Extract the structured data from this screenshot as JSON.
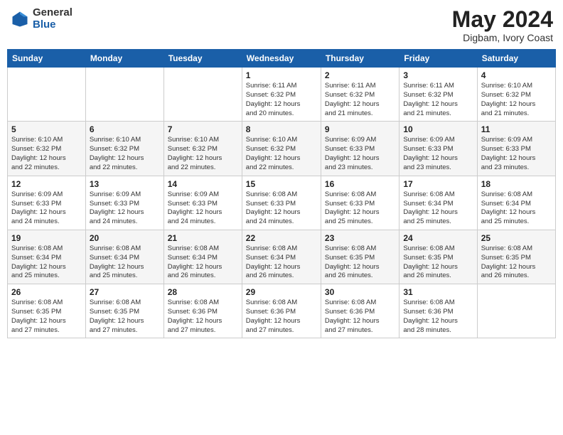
{
  "header": {
    "logo_general": "General",
    "logo_blue": "Blue",
    "month_year": "May 2024",
    "location": "Digbam, Ivory Coast"
  },
  "weekdays": [
    "Sunday",
    "Monday",
    "Tuesday",
    "Wednesday",
    "Thursday",
    "Friday",
    "Saturday"
  ],
  "weeks": [
    [
      {
        "day": "",
        "info": ""
      },
      {
        "day": "",
        "info": ""
      },
      {
        "day": "",
        "info": ""
      },
      {
        "day": "1",
        "info": "Sunrise: 6:11 AM\nSunset: 6:32 PM\nDaylight: 12 hours\nand 20 minutes."
      },
      {
        "day": "2",
        "info": "Sunrise: 6:11 AM\nSunset: 6:32 PM\nDaylight: 12 hours\nand 21 minutes."
      },
      {
        "day": "3",
        "info": "Sunrise: 6:11 AM\nSunset: 6:32 PM\nDaylight: 12 hours\nand 21 minutes."
      },
      {
        "day": "4",
        "info": "Sunrise: 6:10 AM\nSunset: 6:32 PM\nDaylight: 12 hours\nand 21 minutes."
      }
    ],
    [
      {
        "day": "5",
        "info": "Sunrise: 6:10 AM\nSunset: 6:32 PM\nDaylight: 12 hours\nand 22 minutes."
      },
      {
        "day": "6",
        "info": "Sunrise: 6:10 AM\nSunset: 6:32 PM\nDaylight: 12 hours\nand 22 minutes."
      },
      {
        "day": "7",
        "info": "Sunrise: 6:10 AM\nSunset: 6:32 PM\nDaylight: 12 hours\nand 22 minutes."
      },
      {
        "day": "8",
        "info": "Sunrise: 6:10 AM\nSunset: 6:32 PM\nDaylight: 12 hours\nand 22 minutes."
      },
      {
        "day": "9",
        "info": "Sunrise: 6:09 AM\nSunset: 6:33 PM\nDaylight: 12 hours\nand 23 minutes."
      },
      {
        "day": "10",
        "info": "Sunrise: 6:09 AM\nSunset: 6:33 PM\nDaylight: 12 hours\nand 23 minutes."
      },
      {
        "day": "11",
        "info": "Sunrise: 6:09 AM\nSunset: 6:33 PM\nDaylight: 12 hours\nand 23 minutes."
      }
    ],
    [
      {
        "day": "12",
        "info": "Sunrise: 6:09 AM\nSunset: 6:33 PM\nDaylight: 12 hours\nand 24 minutes."
      },
      {
        "day": "13",
        "info": "Sunrise: 6:09 AM\nSunset: 6:33 PM\nDaylight: 12 hours\nand 24 minutes."
      },
      {
        "day": "14",
        "info": "Sunrise: 6:09 AM\nSunset: 6:33 PM\nDaylight: 12 hours\nand 24 minutes."
      },
      {
        "day": "15",
        "info": "Sunrise: 6:08 AM\nSunset: 6:33 PM\nDaylight: 12 hours\nand 24 minutes."
      },
      {
        "day": "16",
        "info": "Sunrise: 6:08 AM\nSunset: 6:33 PM\nDaylight: 12 hours\nand 25 minutes."
      },
      {
        "day": "17",
        "info": "Sunrise: 6:08 AM\nSunset: 6:34 PM\nDaylight: 12 hours\nand 25 minutes."
      },
      {
        "day": "18",
        "info": "Sunrise: 6:08 AM\nSunset: 6:34 PM\nDaylight: 12 hours\nand 25 minutes."
      }
    ],
    [
      {
        "day": "19",
        "info": "Sunrise: 6:08 AM\nSunset: 6:34 PM\nDaylight: 12 hours\nand 25 minutes."
      },
      {
        "day": "20",
        "info": "Sunrise: 6:08 AM\nSunset: 6:34 PM\nDaylight: 12 hours\nand 25 minutes."
      },
      {
        "day": "21",
        "info": "Sunrise: 6:08 AM\nSunset: 6:34 PM\nDaylight: 12 hours\nand 26 minutes."
      },
      {
        "day": "22",
        "info": "Sunrise: 6:08 AM\nSunset: 6:34 PM\nDaylight: 12 hours\nand 26 minutes."
      },
      {
        "day": "23",
        "info": "Sunrise: 6:08 AM\nSunset: 6:35 PM\nDaylight: 12 hours\nand 26 minutes."
      },
      {
        "day": "24",
        "info": "Sunrise: 6:08 AM\nSunset: 6:35 PM\nDaylight: 12 hours\nand 26 minutes."
      },
      {
        "day": "25",
        "info": "Sunrise: 6:08 AM\nSunset: 6:35 PM\nDaylight: 12 hours\nand 26 minutes."
      }
    ],
    [
      {
        "day": "26",
        "info": "Sunrise: 6:08 AM\nSunset: 6:35 PM\nDaylight: 12 hours\nand 27 minutes."
      },
      {
        "day": "27",
        "info": "Sunrise: 6:08 AM\nSunset: 6:35 PM\nDaylight: 12 hours\nand 27 minutes."
      },
      {
        "day": "28",
        "info": "Sunrise: 6:08 AM\nSunset: 6:36 PM\nDaylight: 12 hours\nand 27 minutes."
      },
      {
        "day": "29",
        "info": "Sunrise: 6:08 AM\nSunset: 6:36 PM\nDaylight: 12 hours\nand 27 minutes."
      },
      {
        "day": "30",
        "info": "Sunrise: 6:08 AM\nSunset: 6:36 PM\nDaylight: 12 hours\nand 27 minutes."
      },
      {
        "day": "31",
        "info": "Sunrise: 6:08 AM\nSunset: 6:36 PM\nDaylight: 12 hours\nand 28 minutes."
      },
      {
        "day": "",
        "info": ""
      }
    ]
  ]
}
